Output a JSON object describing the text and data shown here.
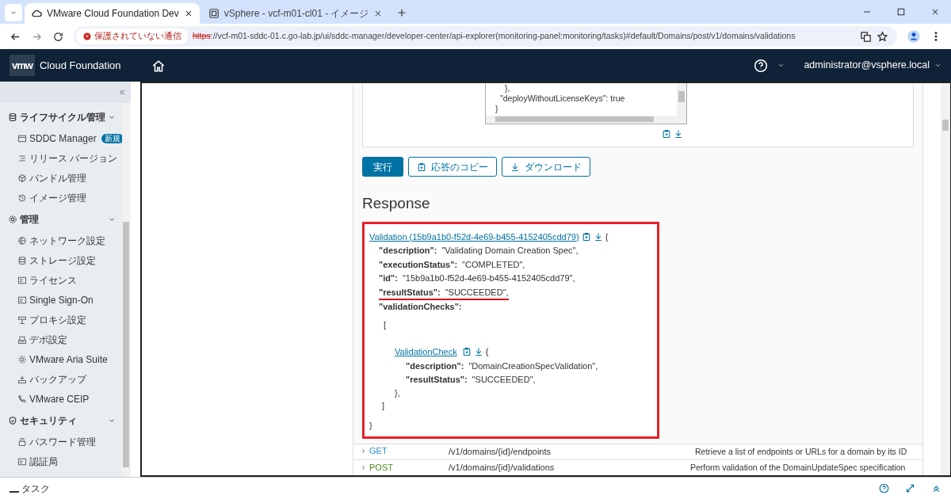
{
  "browser": {
    "tabs": [
      {
        "title": "VMware Cloud Foundation Dev",
        "selected": true
      },
      {
        "title": "vSphere - vcf-m01-cl01 - イメージ",
        "selected": false
      }
    ],
    "security_label": "保護されていない通信",
    "url_scheme": "https",
    "url_rest": "://vcf-m01-sddc-01.c.go-lab.jp/ui/sddc-manager/developer-center/api-explorer(monitoring-panel:monitoring/tasks)#default/Domains/post/v1/domains/validations"
  },
  "app": {
    "logo": "vmw",
    "brand": "Cloud Foundation",
    "user": "administrator@vsphere.local"
  },
  "sidebar": {
    "groups": [
      {
        "label": "ライフサイクル管理",
        "expanded": true,
        "items": [
          {
            "label": "SDDC Manager",
            "badge": "新規"
          },
          {
            "label": "リリース バージョン"
          },
          {
            "label": "バンドル管理"
          },
          {
            "label": "イメージ管理"
          }
        ]
      },
      {
        "label": "管理",
        "expanded": true,
        "items": [
          {
            "label": "ネットワーク設定"
          },
          {
            "label": "ストレージ設定"
          },
          {
            "label": "ライセンス"
          },
          {
            "label": "Single Sign-On"
          },
          {
            "label": "プロキシ設定"
          },
          {
            "label": "デポ設定"
          },
          {
            "label": "VMware Aria Suite"
          },
          {
            "label": "バックアップ"
          },
          {
            "label": "VMware CEIP"
          }
        ]
      },
      {
        "label": "セキュリティ",
        "expanded": true,
        "items": [
          {
            "label": "パスワード管理"
          },
          {
            "label": "認証局"
          }
        ]
      }
    ]
  },
  "request_body": {
    "lines": [
      "},",
      "\"deployWithoutLicenseKeys\": true",
      "}"
    ]
  },
  "buttons": [
    {
      "label": "実行",
      "kind": "primary"
    },
    {
      "label": "応答のコピー",
      "kind": "copy"
    },
    {
      "label": "ダウンロード",
      "kind": "download"
    }
  ],
  "response": {
    "heading": "Response",
    "link": "Validation (15b9a1b0-f52d-4e69-b455-4152405cdd79)",
    "open": "{",
    "fields": [
      {
        "key": "\"description\":",
        "value": "\"Validating Domain Creation Spec\",",
        "underlined": false
      },
      {
        "key": "\"executionStatus\":",
        "value": "\"COMPLETED\",",
        "underlined": false
      },
      {
        "key": "\"id\":",
        "value": "\"15b9a1b0-f52d-4e69-b455-4152405cdd79\",",
        "underlined": false
      },
      {
        "key": "\"resultStatus\":",
        "value": "\"SUCCEEDED\",",
        "underlined": true
      }
    ],
    "list_key": "\"validationChecks\":",
    "list_open": "[",
    "check": {
      "link": "ValidationCheck",
      "open": "{",
      "fields": [
        {
          "key": "\"description\":",
          "value": "\"DomainCreationSpecValidation\","
        },
        {
          "key": "\"resultStatus\":",
          "value": "\"SUCCEEDED\","
        }
      ],
      "close": "},"
    },
    "list_close": "]",
    "close": "}"
  },
  "endpoints": [
    {
      "method": "GET",
      "color": "#2f8fc8",
      "path": "/v1/domains/{id}/endpoints",
      "description": "Retrieve a list of endpoints or URLs for a domain by its ID"
    },
    {
      "method": "POST",
      "color": "#4e8a1e",
      "path": "/v1/domains/{id}/validations",
      "description": "Perform validation of the DomainUpdateSpec specification"
    }
  ],
  "status_bar": {
    "label": "タスク"
  }
}
